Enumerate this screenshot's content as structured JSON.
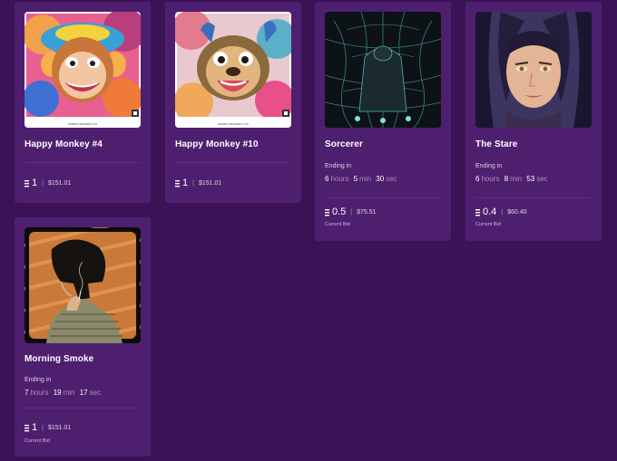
{
  "cards": [
    {
      "title": "Happy Monkey #4",
      "art_caption": "HAPPY MONKEY #4",
      "eth": "1",
      "usd": "$151.01"
    },
    {
      "title": "Happy Monkey #10",
      "art_caption": "HAPPY MONKEY #10",
      "eth": "1",
      "usd": "$151.01"
    },
    {
      "title": "Sorcerer",
      "ending_label": "Ending in",
      "hours": "6",
      "hours_unit": "hours",
      "min": "5",
      "min_unit": "min",
      "sec": "30",
      "sec_unit": "sec",
      "eth": "0.5",
      "usd": "$75.51",
      "bid_label": "Current Bid"
    },
    {
      "title": "The Stare",
      "ending_label": "Ending in",
      "hours": "6",
      "hours_unit": "hours",
      "min": "8",
      "min_unit": "min",
      "sec": "53",
      "sec_unit": "sec",
      "eth": "0.4",
      "usd": "$60.40",
      "bid_label": "Current Bid"
    },
    {
      "title": "Morning Smoke",
      "ending_label": "Ending in",
      "hours": "7",
      "hours_unit": "hours",
      "min": "19",
      "min_unit": "min",
      "sec": "17",
      "sec_unit": "sec",
      "eth": "1",
      "usd": "$151.01",
      "bid_label": "Current Bid"
    }
  ],
  "separator": "|",
  "icons": {
    "currency": "eth-icon"
  },
  "colors": {
    "page_bg": "#3c1257",
    "card_bg": "#4e1f6e",
    "muted_text": "#a88ec0"
  }
}
